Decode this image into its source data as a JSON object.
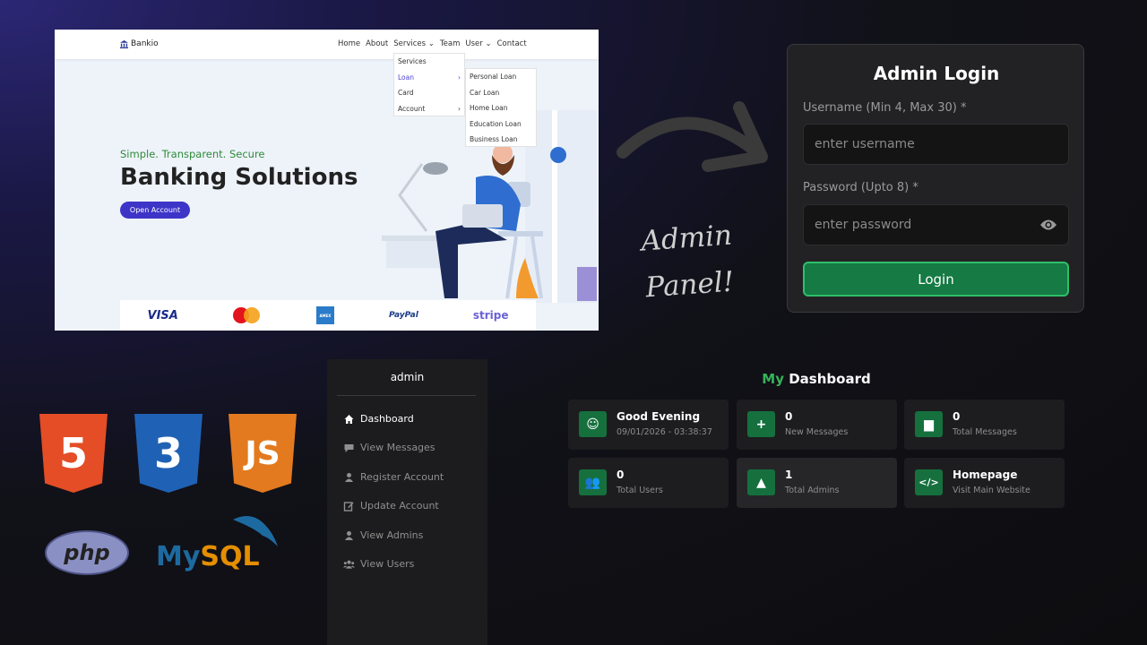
{
  "website": {
    "brand": "Bankio",
    "nav": [
      "Home",
      "About",
      "Services",
      "Team",
      "User",
      "Contact"
    ],
    "services_menu": [
      {
        "label": "Services",
        "has_sub": false
      },
      {
        "label": "Loan",
        "has_sub": true
      },
      {
        "label": "Card",
        "has_sub": false
      },
      {
        "label": "Account",
        "has_sub": true
      }
    ],
    "loan_menu": [
      "Personal Loan",
      "Car Loan",
      "Home Loan",
      "Education Loan",
      "Business Loan"
    ],
    "hero_tag": "Simple. Transparent. Secure",
    "hero_title": "Banking Solutions",
    "hero_button": "Open Account",
    "payments": [
      "VISA",
      "PayPal",
      "stripe"
    ]
  },
  "annotation": {
    "line1": "Admin",
    "line2": "Panel!"
  },
  "login": {
    "title": "Admin Login",
    "username_label": "Username (Min 4, Max 30) *",
    "username_placeholder": "enter username",
    "password_label": "Password (Upto 8) *",
    "password_placeholder": "enter password",
    "button": "Login"
  },
  "tech": {
    "html": "5",
    "css": "3",
    "js": "JS",
    "php": "php",
    "mysql_a": "My",
    "mysql_b": "SQL"
  },
  "sidebar": {
    "title": "admin",
    "items": [
      {
        "label": "Dashboard",
        "icon": "home-icon"
      },
      {
        "label": "View Messages",
        "icon": "chat-icon"
      },
      {
        "label": "Register Account",
        "icon": "user-icon"
      },
      {
        "label": "Update Account",
        "icon": "edit-icon"
      },
      {
        "label": "View Admins",
        "icon": "user-icon"
      },
      {
        "label": "View Users",
        "icon": "users-icon"
      }
    ]
  },
  "dashboard": {
    "title_my": "My",
    "title_rest": "Dashboard",
    "cards": [
      {
        "value": "Good Evening",
        "label": "09/01/2026 - 03:38:37",
        "icon": "smile-icon",
        "glyph": "☺"
      },
      {
        "value": "0",
        "label": "New Messages",
        "icon": "message-plus-icon",
        "glyph": "+"
      },
      {
        "value": "0",
        "label": "Total Messages",
        "icon": "chat-icon",
        "glyph": "▆"
      },
      {
        "value": "0",
        "label": "Total Users",
        "icon": "users-icon",
        "glyph": "👥"
      },
      {
        "value": "1",
        "label": "Total Admins",
        "icon": "admin-icon",
        "glyph": "▲"
      },
      {
        "value": "Homepage",
        "label": "Visit Main Website",
        "icon": "code-icon",
        "glyph": "</>"
      }
    ]
  },
  "colors": {
    "accent_green": "#35b35a",
    "login_button": "#157a43",
    "brand_purple": "#3d34c8"
  }
}
